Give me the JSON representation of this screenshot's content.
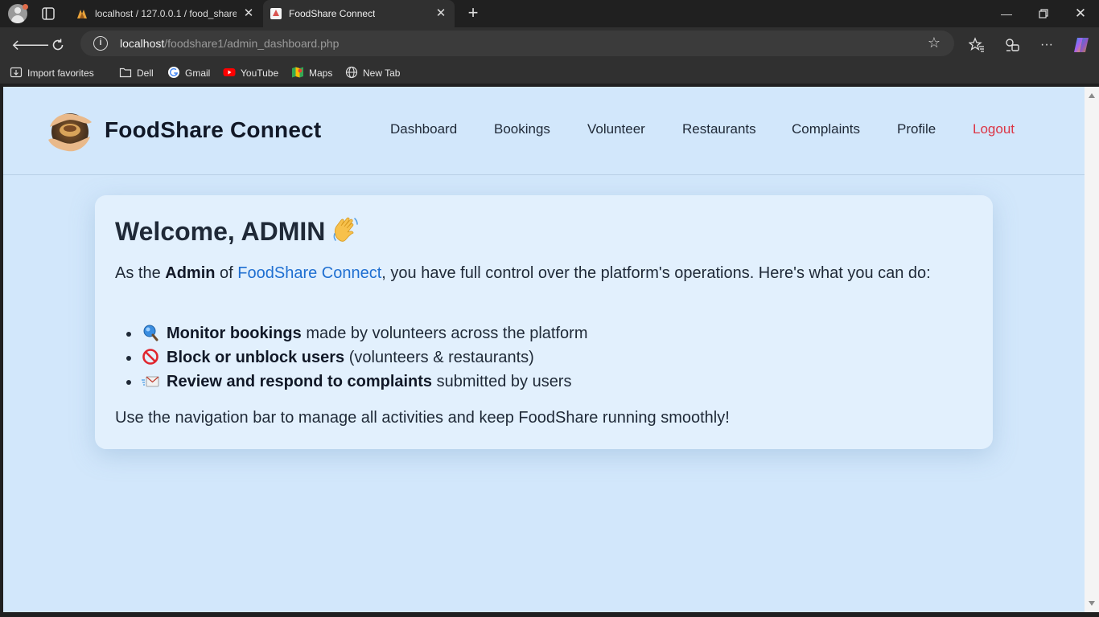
{
  "browser": {
    "tabs": [
      {
        "title": "localhost / 127.0.0.1 / food_share",
        "active": false
      },
      {
        "title": "FoodShare Connect",
        "active": true
      }
    ],
    "url_host": "localhost",
    "url_path": "/foodshare1/admin_dashboard.php",
    "bookmarks": [
      "Import favorites",
      "Dell",
      "Gmail",
      "YouTube",
      "Maps",
      "New Tab"
    ]
  },
  "site": {
    "brand": "FoodShare Connect",
    "nav": [
      "Dashboard",
      "Bookings",
      "Volunteer",
      "Restaurants",
      "Complaints",
      "Profile",
      "Logout"
    ],
    "logout_color": "#dc3545",
    "accent_link_color": "#1f6fd1"
  },
  "welcome": {
    "heading": "Welcome, ADMIN",
    "intro_prefix": "As the ",
    "intro_role": "Admin",
    "intro_of": " of ",
    "intro_link": "FoodShare Connect",
    "intro_rest": ", you have full control over the platform's operations. Here's what you can do:",
    "items": [
      {
        "icon": "magnifier-icon",
        "bold": "Monitor bookings",
        "rest": " made by volunteers across the platform"
      },
      {
        "icon": "prohibited-icon",
        "bold": "Block or unblock users",
        "rest": " (volunteers & restaurants)"
      },
      {
        "icon": "incoming-envelope-icon",
        "bold": "Review and respond to complaints",
        "rest": " submitted by users"
      }
    ],
    "outro": "Use the navigation bar to manage all activities and keep FoodShare running smoothly!"
  }
}
